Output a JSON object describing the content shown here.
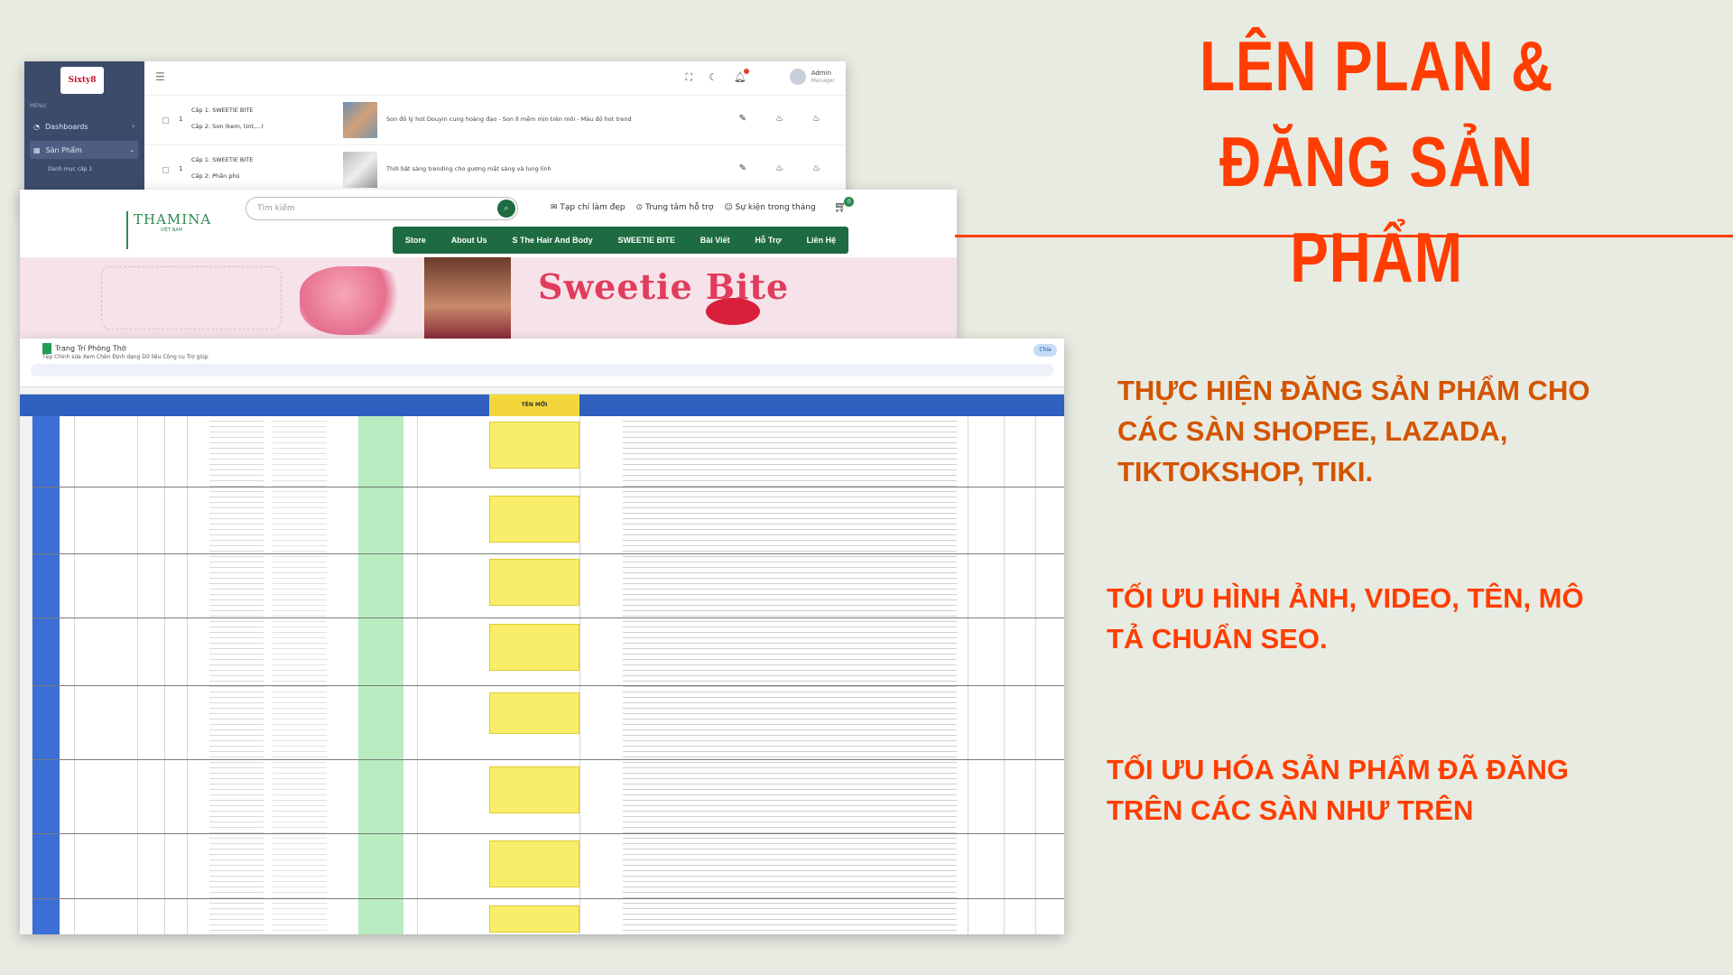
{
  "headline": {
    "line1": "LÊN PLAN &",
    "line2": "ĐĂNG SẢN PHẨM"
  },
  "bullets": [
    {
      "line1": "THỰC HIỆN ĐĂNG SẢN PHẨM CHO",
      "line2": "CÁC SÀN SHOPEE, LAZADA,",
      "line3": "TIKTOKSHOP, TIKI."
    },
    {
      "line1": "TỐI ƯU HÌNH ẢNH, VIDEO, TÊN, MÔ",
      "line2": "TẢ CHUẨN SEO."
    },
    {
      "line1": "TỐI ƯU HÓA SẢN PHẨM ĐÃ ĐĂNG",
      "line2": "TRÊN CÁC SÀN NHƯ TRÊN"
    }
  ],
  "admin": {
    "logo": "Sixty8",
    "menu_heading": "MENU",
    "sidebar": [
      {
        "label": "Dashboards",
        "icon": "dashboard-icon"
      },
      {
        "label": "Sản Phẩm",
        "icon": "grid-icon"
      }
    ],
    "submenu": "Danh mục cấp 1",
    "user": {
      "name": "Admin",
      "role": "Manager"
    },
    "rows": [
      {
        "num": "1",
        "cat1": "Cấp 1: SWEETIE BITE",
        "cat2": "Cấp 2: Son (kem, tint,...)",
        "desc": "Son đỏ lý hot Douyin cung hoàng đạo - Son lì mềm mịn trên môi - Màu đỏ hot trend"
      },
      {
        "num": "1",
        "cat1": "Cấp 1: SWEETIE BITE",
        "cat2": "Cấp 2: Phấn phủ",
        "desc": "Thời bật sáng trending cho gương mặt sáng và lung linh"
      }
    ]
  },
  "shop": {
    "brand": "THAMINA",
    "brand_sub": "VIỆT NAM",
    "search_placeholder": "Tìm kiếm",
    "links": [
      "Tạp chí làm đẹp",
      "Trung tâm hỗ trợ",
      "Sự kiện trong tháng"
    ],
    "cart_count": "0",
    "nav": [
      "Store",
      "About Us",
      "S The Hair And Body",
      "SWEETIE BITE",
      "Bài Viết",
      "Hỗ Trợ",
      "Liên Hệ"
    ],
    "banner_text": "Sweetie Bite"
  },
  "sheet": {
    "title": "Trang Trí Phòng Thờ",
    "menus": "Tệp   Chỉnh sửa   Xem   Chèn   Định dạng   Dữ liệu   Công cụ   Trợ giúp",
    "share": "Chia",
    "highlight_header": "TÊN MỚI"
  },
  "colors": {
    "accent": "#ff3d00",
    "accent_dark": "#d35400",
    "background": "#e8ebe2",
    "sheet_header": "#2f5fbf",
    "shop_green": "#1e6b41"
  }
}
